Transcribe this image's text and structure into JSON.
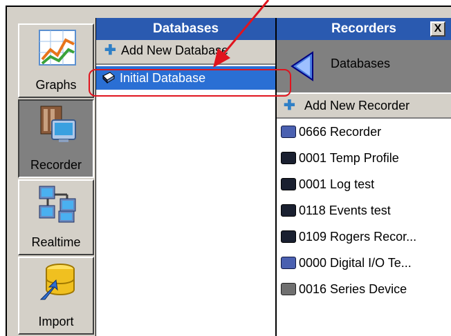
{
  "nav": {
    "graphs": "Graphs",
    "recorder": "Recorder",
    "realtime": "Realtime",
    "import": "Import"
  },
  "databases_panel": {
    "title": "Databases",
    "add_label": "Add New Database",
    "items": [
      {
        "label": "Initial Database",
        "selected": true
      }
    ]
  },
  "recorders_panel": {
    "title": "Recorders",
    "close": "X",
    "back_label": "Databases",
    "add_label": "Add New Recorder",
    "items": [
      {
        "label": "0666 Recorder",
        "icon": "recorder-blue-icon"
      },
      {
        "label": "0001 Temp Profile",
        "icon": "recorder-dark-icon"
      },
      {
        "label": "0001 Log test",
        "icon": "recorder-dark-icon"
      },
      {
        "label": "0118 Events test",
        "icon": "recorder-dark-icon"
      },
      {
        "label": "0109 Rogers Recor...",
        "icon": "recorder-dark-icon"
      },
      {
        "label": "0000 Digital I/O Te...",
        "icon": "recorder-blue-icon"
      },
      {
        "label": "0016 Series Device",
        "icon": "recorder-grey-icon"
      }
    ]
  },
  "colors": {
    "header_blue": "#2a5ab0",
    "selection_blue": "#2a6fd4",
    "annotation_red": "#e0141e",
    "panel_grey": "#d4d0c8"
  }
}
